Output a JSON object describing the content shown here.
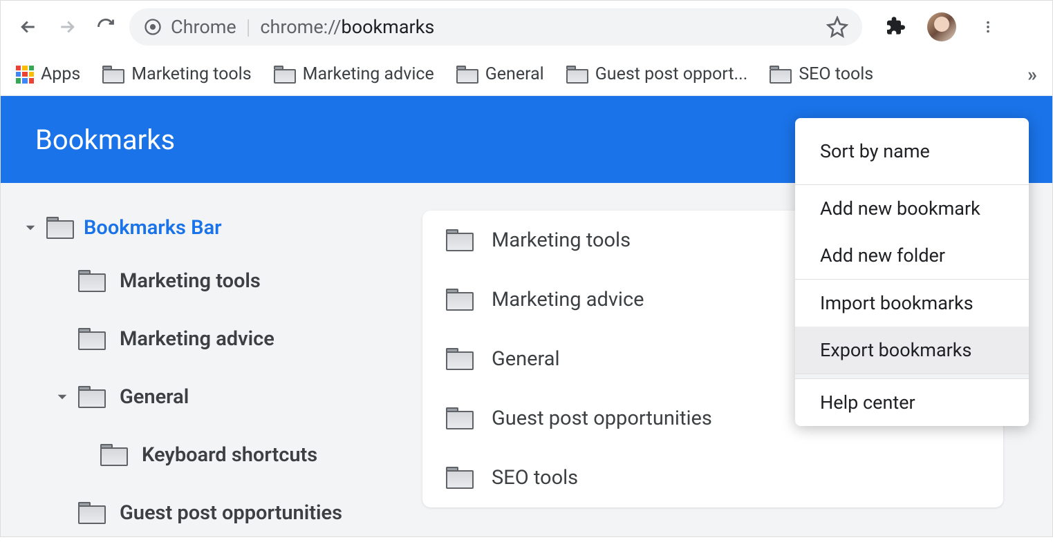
{
  "toolbar": {
    "url_prefix": "Chrome",
    "url_host": "chrome://",
    "url_path": "bookmarks"
  },
  "bookmarks_bar": {
    "apps_label": "Apps",
    "items": [
      {
        "label": "Marketing tools"
      },
      {
        "label": "Marketing advice"
      },
      {
        "label": "General"
      },
      {
        "label": "Guest post opport..."
      },
      {
        "label": "SEO tools"
      }
    ]
  },
  "manager": {
    "title": "Bookmarks",
    "tree": {
      "root_label": "Bookmarks Bar",
      "items": [
        {
          "label": "Marketing tools"
        },
        {
          "label": "Marketing advice"
        },
        {
          "label": "General",
          "expandable": true,
          "children": [
            {
              "label": "Keyboard shortcuts"
            },
            {
              "label": "Guest post opportunities"
            }
          ]
        }
      ]
    },
    "list": [
      {
        "label": "Marketing tools"
      },
      {
        "label": "Marketing advice"
      },
      {
        "label": "General"
      },
      {
        "label": "Guest post opportunities"
      },
      {
        "label": "SEO tools"
      }
    ]
  },
  "dropdown": {
    "sort": "Sort by name",
    "add_bookmark": "Add new bookmark",
    "add_folder": "Add new folder",
    "import_bm": "Import bookmarks",
    "export_bm": "Export bookmarks",
    "help": "Help center"
  }
}
